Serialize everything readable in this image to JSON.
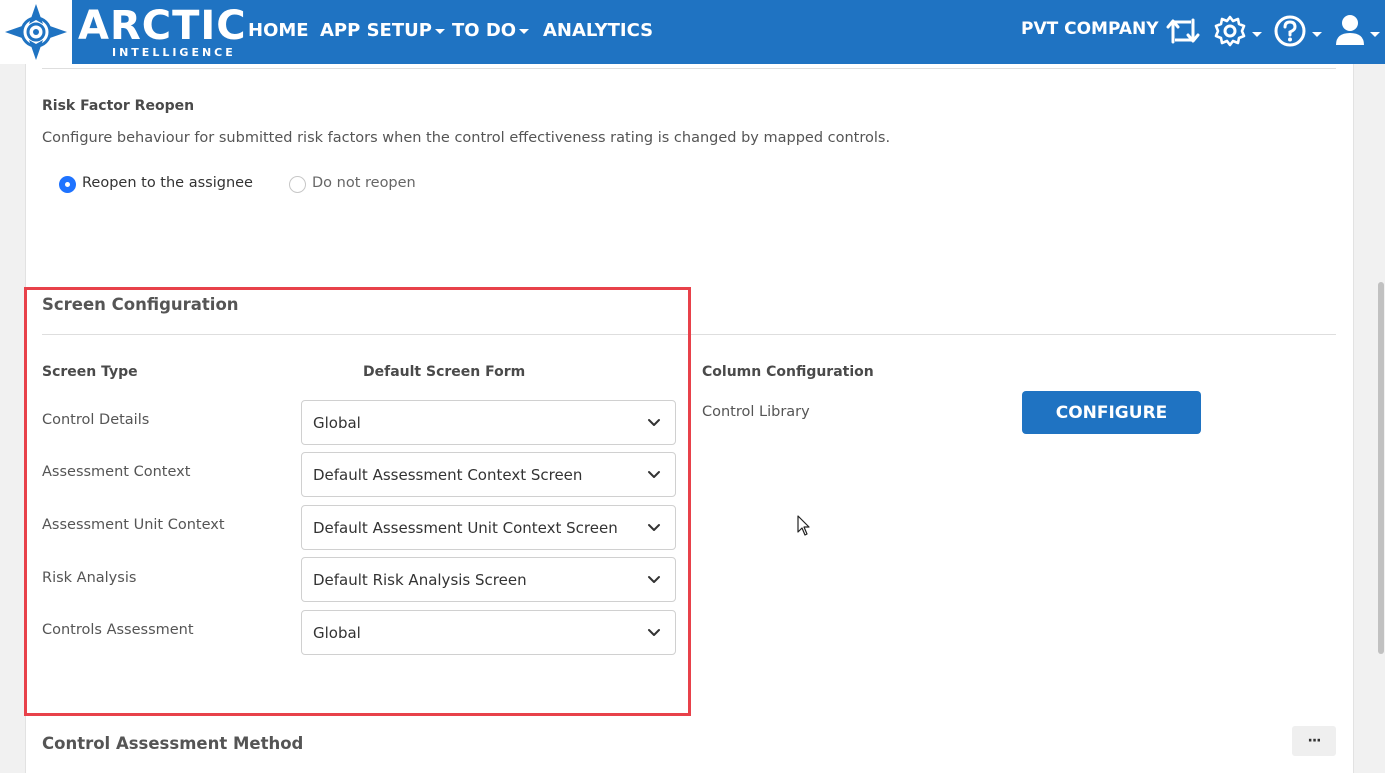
{
  "header": {
    "brand_name": "ARCTIC",
    "brand_sub": "INTELLIGENCE",
    "nav": [
      {
        "label": "HOME",
        "dropdown": false
      },
      {
        "label": "APP SETUP",
        "dropdown": true
      },
      {
        "label": "TO DO",
        "dropdown": true
      },
      {
        "label": "ANALYTICS",
        "dropdown": false
      }
    ],
    "company": "PVT COMPANY",
    "icons": [
      "switch-icon",
      "gear-icon",
      "help-icon",
      "user-icon"
    ]
  },
  "risk_factor_reopen": {
    "title": "Risk Factor Reopen",
    "description": "Configure behaviour for submitted risk factors when the control effectiveness rating is changed by mapped controls.",
    "options": [
      {
        "label": "Reopen to the assignee",
        "selected": true
      },
      {
        "label": "Do not reopen",
        "selected": false
      }
    ]
  },
  "screen_configuration": {
    "title": "Screen Configuration",
    "col_screen_type": "Screen Type",
    "col_default_form": "Default Screen Form",
    "rows": [
      {
        "type": "Control Details",
        "form": "Global"
      },
      {
        "type": "Assessment Context",
        "form": "Default Assessment Context Screen"
      },
      {
        "type": "Assessment Unit Context",
        "form": "Default Assessment Unit Context Screen"
      },
      {
        "type": "Risk Analysis",
        "form": "Default Risk Analysis Screen"
      },
      {
        "type": "Controls Assessment",
        "form": "Global"
      }
    ],
    "column_configuration": {
      "title": "Column Configuration",
      "item": "Control Library",
      "button": "CONFIGURE"
    }
  },
  "control_assessment_method": {
    "title": "Control Assessment Method",
    "more": "···"
  },
  "colors": {
    "header_bg": "#1f73c2",
    "highlight": "#e8414a",
    "radio_on": "#1f73ff"
  }
}
